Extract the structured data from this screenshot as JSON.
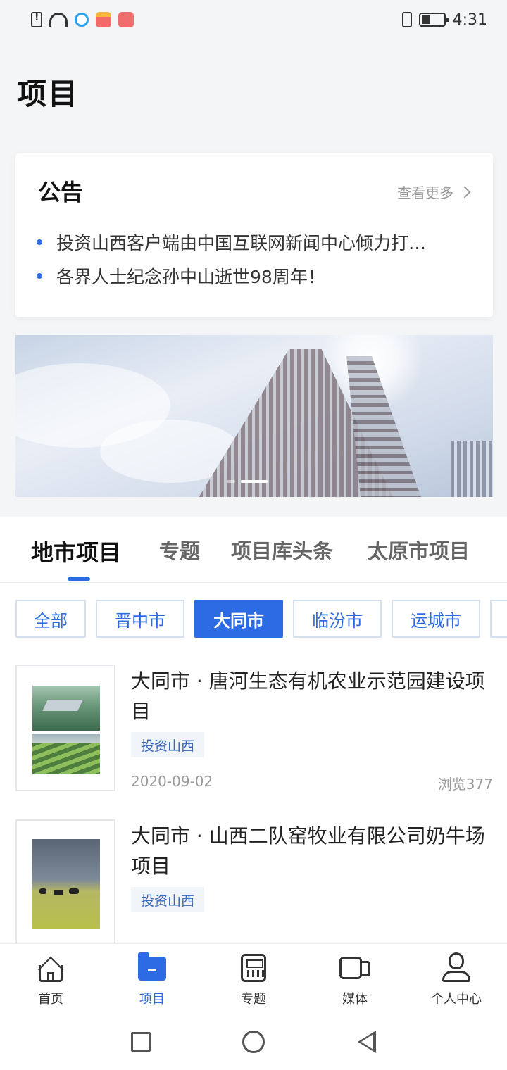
{
  "status_bar": {
    "time": "4:31"
  },
  "page": {
    "title": "项目"
  },
  "notice": {
    "title": "公告",
    "more_label": "查看更多",
    "items": [
      {
        "text": "投资山西客户端由中国互联网新闻中心倾力打…"
      },
      {
        "text": "各界人士纪念孙中山逝世98周年！"
      }
    ]
  },
  "tabs": [
    {
      "label": "地市项目",
      "active": true
    },
    {
      "label": "专题"
    },
    {
      "label": "项目库头条"
    },
    {
      "label": "太原市项目"
    }
  ],
  "filters": [
    {
      "label": "全部"
    },
    {
      "label": "晋中市"
    },
    {
      "label": "大同市",
      "active": true
    },
    {
      "label": "临汾市"
    },
    {
      "label": "运城市"
    }
  ],
  "projects": [
    {
      "title": "大同市 · 唐河生态有机农业示范园建设项目",
      "tag": "投资山西",
      "date": "2020-09-02",
      "views": "浏览377"
    },
    {
      "title": "大同市 · 山西二队窑牧业有限公司奶牛场项目",
      "tag": "投资山西"
    }
  ],
  "bottom_nav": [
    {
      "label": "首页",
      "icon": "home-icon"
    },
    {
      "label": "项目",
      "icon": "folder-icon",
      "active": true
    },
    {
      "label": "专题",
      "icon": "calculator-icon"
    },
    {
      "label": "媒体",
      "icon": "video-icon"
    },
    {
      "label": "个人中心",
      "icon": "user-icon"
    }
  ],
  "colors": {
    "accent": "#2d6be4",
    "tag_text": "#3566b8"
  }
}
